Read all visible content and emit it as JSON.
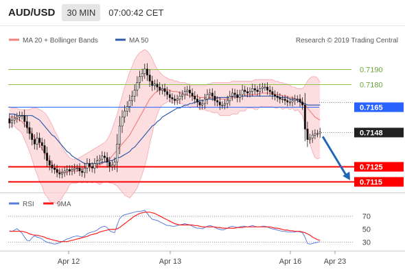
{
  "header": {
    "pair": "AUD/USD",
    "timeframe": "30 MIN",
    "time": "07:00:42 CET"
  },
  "credit": "Research © 2019 Trading Central",
  "colors": {
    "ma20": "#f08080",
    "ma50": "#2e5aa8",
    "bollinger_fill": "#fbd3d6",
    "candle": "#111111",
    "support": "#ff0000",
    "pivot": "#2962ff",
    "resistance": "#8bc34a",
    "last": "#222222",
    "rsi": "#5b7bdb",
    "rsi_ma": "#ff1a1a",
    "arrow": "#2166b5"
  },
  "chart_data": [
    {
      "type": "candlestick",
      "legend": [
        "MA 20 + Bollinger Bands",
        "MA 50"
      ],
      "ylim": [
        0.711,
        0.7205
      ],
      "x_ticks": [
        "Apr 12",
        "Apr 13",
        "Apr 16",
        "Apr 23"
      ],
      "levels": [
        {
          "label": "0.7190",
          "value": 0.719,
          "kind": "resistance"
        },
        {
          "label": "0.7180",
          "value": 0.718,
          "kind": "resistance"
        },
        {
          "label": "0.7165",
          "value": 0.7165,
          "kind": "pivot"
        },
        {
          "label": "0.7148",
          "value": 0.7148,
          "kind": "last"
        },
        {
          "label": "0.7125",
          "value": 0.7125,
          "kind": "support"
        },
        {
          "label": "0.7115",
          "value": 0.7115,
          "kind": "support"
        }
      ],
      "close": [
        0.7154,
        0.7156,
        0.7157,
        0.7158,
        0.7159,
        0.7159,
        0.7155,
        0.7151,
        0.7147,
        0.7143,
        0.714,
        0.7144,
        0.7141,
        0.7139,
        0.7134,
        0.7129,
        0.7126,
        0.7124,
        0.7123,
        0.7121,
        0.712,
        0.7121,
        0.7122,
        0.7123,
        0.7122,
        0.7123,
        0.7124,
        0.7124,
        0.7122,
        0.7121,
        0.7124,
        0.7127,
        0.7125,
        0.7124,
        0.7127,
        0.7129,
        0.713,
        0.7132,
        0.7131,
        0.7128,
        0.7125,
        0.7126,
        0.7128,
        0.714,
        0.7152,
        0.7158,
        0.7162,
        0.7165,
        0.7169,
        0.7172,
        0.7176,
        0.7181,
        0.7185,
        0.7187,
        0.719,
        0.7186,
        0.7182,
        0.7179,
        0.718,
        0.7178,
        0.7176,
        0.7177,
        0.7175,
        0.7173,
        0.7171,
        0.717,
        0.7169,
        0.717,
        0.7172,
        0.7173,
        0.7175,
        0.7176,
        0.7174,
        0.7172,
        0.717,
        0.7168,
        0.7166,
        0.7167,
        0.717,
        0.7173,
        0.7174,
        0.7172,
        0.7169,
        0.7168,
        0.7166,
        0.7166,
        0.7167,
        0.7169,
        0.7172,
        0.7174,
        0.7173,
        0.7171,
        0.7173,
        0.7176,
        0.7175,
        0.7174,
        0.7175,
        0.7177,
        0.7176,
        0.7175,
        0.7177,
        0.7178,
        0.7178,
        0.7176,
        0.7175,
        0.7173,
        0.7172,
        0.7171,
        0.717,
        0.717,
        0.7169,
        0.7168,
        0.7168,
        0.7169,
        0.717,
        0.717,
        0.7168,
        0.7166,
        0.715,
        0.7143,
        0.7144,
        0.7146,
        0.7147,
        0.7147,
        0.7148
      ],
      "ma20": [
        0.7158,
        0.7158,
        0.7158,
        0.7157,
        0.7156,
        0.7155,
        0.7153,
        0.7151,
        0.7149,
        0.7147,
        0.7144,
        0.7142,
        0.7139,
        0.7137,
        0.7134,
        0.7132,
        0.7129,
        0.7127,
        0.7125,
        0.7123,
        0.7122,
        0.7121,
        0.7121,
        0.7121,
        0.7122,
        0.7122,
        0.7122,
        0.7122,
        0.7123,
        0.7123,
        0.7124,
        0.7124,
        0.7125,
        0.7125,
        0.7126,
        0.7126,
        0.7126,
        0.7127,
        0.7128,
        0.7129,
        0.713,
        0.7132,
        0.7134,
        0.7136,
        0.7138,
        0.714,
        0.7142,
        0.7144,
        0.7146,
        0.7149,
        0.7152,
        0.7155,
        0.7158,
        0.7161,
        0.7164,
        0.7167,
        0.717,
        0.7172,
        0.7174,
        0.7175,
        0.7176,
        0.7176,
        0.7176,
        0.7176,
        0.7176,
        0.7175,
        0.7175,
        0.7175,
        0.7174,
        0.7174,
        0.7173,
        0.7173,
        0.7172,
        0.7172,
        0.7172,
        0.7172,
        0.7171,
        0.7171,
        0.7171,
        0.7171,
        0.7171,
        0.7171,
        0.7171,
        0.7171,
        0.717,
        0.717,
        0.717,
        0.717,
        0.717,
        0.7171,
        0.7171,
        0.7171,
        0.7172,
        0.7172,
        0.7172,
        0.7173,
        0.7173,
        0.7173,
        0.7173,
        0.7173,
        0.7174,
        0.7174,
        0.7174,
        0.7174,
        0.7174,
        0.7174,
        0.7173,
        0.7173,
        0.7173,
        0.7172,
        0.7172,
        0.7172,
        0.7171,
        0.7171,
        0.717,
        0.717,
        0.7169,
        0.7168,
        0.7166,
        0.7164,
        0.7162,
        0.716,
        0.7158,
        0.7157,
        0.7156
      ],
      "bb_upper": [
        0.7165,
        0.7164,
        0.7164,
        0.7164,
        0.7163,
        0.7163,
        0.7163,
        0.7163,
        0.7163,
        0.7164,
        0.7164,
        0.7164,
        0.7163,
        0.7162,
        0.7161,
        0.7159,
        0.7156,
        0.7153,
        0.7149,
        0.7146,
        0.7142,
        0.7138,
        0.7135,
        0.7133,
        0.7131,
        0.713,
        0.713,
        0.713,
        0.7131,
        0.7132,
        0.7133,
        0.7134,
        0.7135,
        0.7136,
        0.7137,
        0.7138,
        0.7139,
        0.714,
        0.7141,
        0.7143,
        0.7146,
        0.715,
        0.7155,
        0.716,
        0.7166,
        0.7172,
        0.7178,
        0.7183,
        0.7188,
        0.7192,
        0.7196,
        0.7199,
        0.7201,
        0.7202,
        0.7203,
        0.7202,
        0.72,
        0.7197,
        0.7193,
        0.719,
        0.7188,
        0.7186,
        0.7185,
        0.7184,
        0.7183,
        0.7183,
        0.7182,
        0.7182,
        0.7181,
        0.7181,
        0.7181,
        0.718,
        0.718,
        0.7179,
        0.7179,
        0.7179,
        0.7179,
        0.7179,
        0.7179,
        0.718,
        0.718,
        0.7181,
        0.7181,
        0.7181,
        0.7181,
        0.7181,
        0.7181,
        0.7181,
        0.7181,
        0.7182,
        0.7182,
        0.7182,
        0.7182,
        0.7182,
        0.7182,
        0.7182,
        0.7182,
        0.7182,
        0.7183,
        0.7183,
        0.7183,
        0.7183,
        0.7183,
        0.7183,
        0.7183,
        0.7183,
        0.7182,
        0.7182,
        0.7181,
        0.7181,
        0.718,
        0.718,
        0.7179,
        0.7178,
        0.7178,
        0.7177,
        0.7177,
        0.7177,
        0.7179,
        0.7182,
        0.7184,
        0.7185,
        0.7185,
        0.7184,
        0.7181
      ],
      "bb_lower": [
        0.7151,
        0.7152,
        0.7152,
        0.715,
        0.7149,
        0.7147,
        0.7143,
        0.7139,
        0.7135,
        0.713,
        0.7124,
        0.712,
        0.7115,
        0.7112,
        0.7107,
        0.7105,
        0.7102,
        0.7101,
        0.7101,
        0.71,
        0.7102,
        0.7104,
        0.7107,
        0.7109,
        0.7113,
        0.7114,
        0.7114,
        0.7114,
        0.7115,
        0.7114,
        0.7115,
        0.7114,
        0.7115,
        0.7114,
        0.7115,
        0.7114,
        0.7113,
        0.7114,
        0.7115,
        0.7115,
        0.7114,
        0.7114,
        0.7113,
        0.7112,
        0.711,
        0.7108,
        0.7106,
        0.7105,
        0.7104,
        0.7106,
        0.7108,
        0.7111,
        0.7115,
        0.712,
        0.7125,
        0.7132,
        0.714,
        0.7147,
        0.7155,
        0.716,
        0.7164,
        0.7166,
        0.7167,
        0.7168,
        0.7169,
        0.7167,
        0.7168,
        0.7168,
        0.7167,
        0.7167,
        0.7165,
        0.7166,
        0.7164,
        0.7165,
        0.7165,
        0.7165,
        0.7163,
        0.7163,
        0.7163,
        0.7162,
        0.7162,
        0.7161,
        0.7161,
        0.7161,
        0.7159,
        0.7159,
        0.7159,
        0.7159,
        0.7159,
        0.716,
        0.716,
        0.716,
        0.7162,
        0.7162,
        0.7162,
        0.7164,
        0.7164,
        0.7164,
        0.7163,
        0.7163,
        0.7165,
        0.7165,
        0.7165,
        0.7165,
        0.7165,
        0.7165,
        0.7164,
        0.7164,
        0.7165,
        0.7163,
        0.7164,
        0.7164,
        0.7163,
        0.7164,
        0.7162,
        0.7163,
        0.7161,
        0.7159,
        0.7153,
        0.7146,
        0.714,
        0.7135,
        0.7131,
        0.713,
        0.7131
      ],
      "ma50": [
        0.716,
        0.716,
        0.716,
        0.7159,
        0.7159,
        0.7159,
        0.7159,
        0.7159,
        0.7159,
        0.7159,
        0.7158,
        0.7157,
        0.7156,
        0.7154,
        0.7152,
        0.715,
        0.7148,
        0.7146,
        0.7145,
        0.7143,
        0.7141,
        0.7139,
        0.7137,
        0.7135,
        0.7134,
        0.7132,
        0.7131,
        0.713,
        0.7129,
        0.7128,
        0.7127,
        0.7127,
        0.7127,
        0.7127,
        0.7127,
        0.7127,
        0.7127,
        0.7128,
        0.7128,
        0.7128,
        0.7129,
        0.7129,
        0.713,
        0.7131,
        0.7131,
        0.7132,
        0.7133,
        0.7134,
        0.7135,
        0.7137,
        0.7138,
        0.714,
        0.7142,
        0.7144,
        0.7146,
        0.7148,
        0.715,
        0.7152,
        0.7153,
        0.7155,
        0.7156,
        0.7158,
        0.7159,
        0.716,
        0.7161,
        0.7162,
        0.7163,
        0.7164,
        0.7164,
        0.7165,
        0.7166,
        0.7166,
        0.7167,
        0.7167,
        0.7168,
        0.7168,
        0.7169,
        0.7169,
        0.7169,
        0.717,
        0.717,
        0.717,
        0.717,
        0.7171,
        0.7171,
        0.7171,
        0.7171,
        0.7171,
        0.7171,
        0.7172,
        0.7172,
        0.7172,
        0.7172,
        0.7172,
        0.7172,
        0.7172,
        0.7172,
        0.7172,
        0.7172,
        0.7172,
        0.7172,
        0.7172,
        0.7172,
        0.7172,
        0.7172,
        0.7172,
        0.7172,
        0.7172,
        0.7171,
        0.7171,
        0.7171,
        0.7171,
        0.717,
        0.717,
        0.717,
        0.7169,
        0.7168,
        0.7167,
        0.7167,
        0.7166,
        0.7166,
        0.7166,
        0.7166,
        0.7166,
        0.7166
      ],
      "forecast": {
        "from": 0.7145,
        "to": 0.7115
      }
    },
    {
      "type": "line",
      "legend": [
        "RSI",
        "9MA"
      ],
      "ylim": [
        20,
        80
      ],
      "y_ticks": [
        30,
        50,
        70
      ],
      "rsi": [
        47,
        46,
        48,
        50,
        47,
        43,
        37,
        32,
        31,
        36,
        39,
        37,
        36,
        34,
        31,
        29,
        28,
        27,
        26,
        27,
        28,
        30,
        32,
        34,
        35,
        37,
        38,
        39,
        38,
        37,
        39,
        42,
        44,
        45,
        46,
        48,
        51,
        53,
        54,
        52,
        47,
        45,
        44,
        56,
        66,
        70,
        72,
        73,
        74,
        75,
        76,
        77,
        77,
        78,
        79,
        74,
        69,
        65,
        64,
        63,
        61,
        59,
        57,
        55,
        55,
        54,
        54,
        55,
        56,
        57,
        58,
        57,
        56,
        54,
        52,
        51,
        51,
        50,
        52,
        54,
        55,
        54,
        52,
        50,
        49,
        48,
        49,
        51,
        53,
        54,
        53,
        52,
        53,
        54,
        54,
        53,
        54,
        55,
        54,
        53,
        53,
        54,
        54,
        53,
        51,
        50,
        49,
        48,
        47,
        46,
        46,
        45,
        45,
        45,
        45,
        46,
        45,
        44,
        37,
        27,
        26,
        27,
        28,
        29,
        30
      ],
      "ma": [
        46,
        46,
        46,
        46,
        46,
        46,
        45,
        44,
        42,
        41,
        40,
        40,
        39,
        38,
        37,
        35,
        34,
        33,
        32,
        31,
        30,
        30,
        30,
        30,
        31,
        32,
        33,
        34,
        35,
        36,
        37,
        38,
        40,
        41,
        42,
        43,
        45,
        46,
        47,
        48,
        49,
        49,
        49,
        50,
        52,
        55,
        58,
        61,
        64,
        67,
        70,
        72,
        74,
        75,
        76,
        76,
        76,
        75,
        74,
        72,
        70,
        68,
        66,
        64,
        62,
        60,
        58,
        57,
        56,
        56,
        56,
        56,
        56,
        56,
        55,
        55,
        54,
        53,
        53,
        53,
        53,
        53,
        53,
        52,
        52,
        51,
        51,
        51,
        51,
        51,
        51,
        52,
        52,
        52,
        53,
        53,
        53,
        53,
        53,
        53,
        53,
        53,
        53,
        53,
        53,
        52,
        51,
        51,
        50,
        49,
        48,
        48,
        47,
        47,
        46,
        46,
        46,
        45,
        44,
        42,
        40,
        37,
        35,
        33,
        32
      ]
    }
  ]
}
